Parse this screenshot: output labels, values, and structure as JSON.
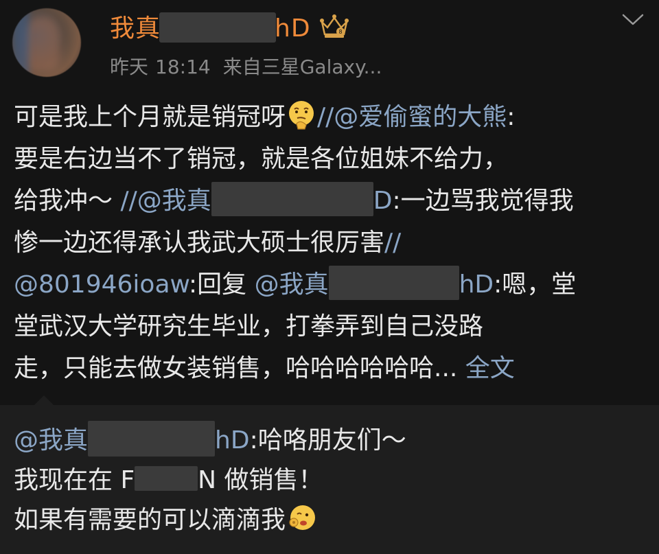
{
  "post": {
    "username_prefix": "我真",
    "username_suffix": "hD",
    "time_label": "昨天",
    "time": "18:14",
    "source": "来自三星Galaxy...",
    "lines": {
      "l1_text": "可是我上个月就是销冠呀",
      "l1_slash": "//",
      "l1_mention": "@爱偷蜜的大熊",
      "l1_colon": ":",
      "l2_text": "要是右边当不了销冠，就是各位姐妹不给力，",
      "l3_text": "给我冲～ ",
      "l3_slash": "//",
      "l3_mention_a": "@我真",
      "l3_mention_b": "D",
      "l3_after": ":一边骂我觉得我",
      "l4_text": "惨一边还得承认我武大硕士很厉害",
      "l4_slash": "//",
      "l5_mention": "@801946ioaw",
      "l5_reply": ":回复 ",
      "l5_mention2_a": "@我真",
      "l5_mention2_b": "hD",
      "l5_after": ":嗯，堂",
      "l6_text": "堂武汉大学研究生毕业，打拳弄到自己没路",
      "l7_text": "走，只能去做女装销售，哈哈哈哈哈哈... ",
      "l7_fulltext": "全文"
    }
  },
  "repost": {
    "mention_a": "@我真",
    "mention_b": "hD",
    "after": ":哈咯朋友们～",
    "line2_a": "我现在在 F",
    "line2_b": "N 做销售！",
    "line3": "如果有需要的可以滴滴我"
  },
  "icons": {
    "crown": "crown-badge-icon",
    "more": "chevron-down-icon",
    "emoji1": "thinking-face-emoji",
    "emoji2": "winking-face-emoji"
  },
  "colors": {
    "background": "#141414",
    "username": "#ef8a3a",
    "link": "#8ba6c6",
    "meta": "#8a8a8a"
  }
}
